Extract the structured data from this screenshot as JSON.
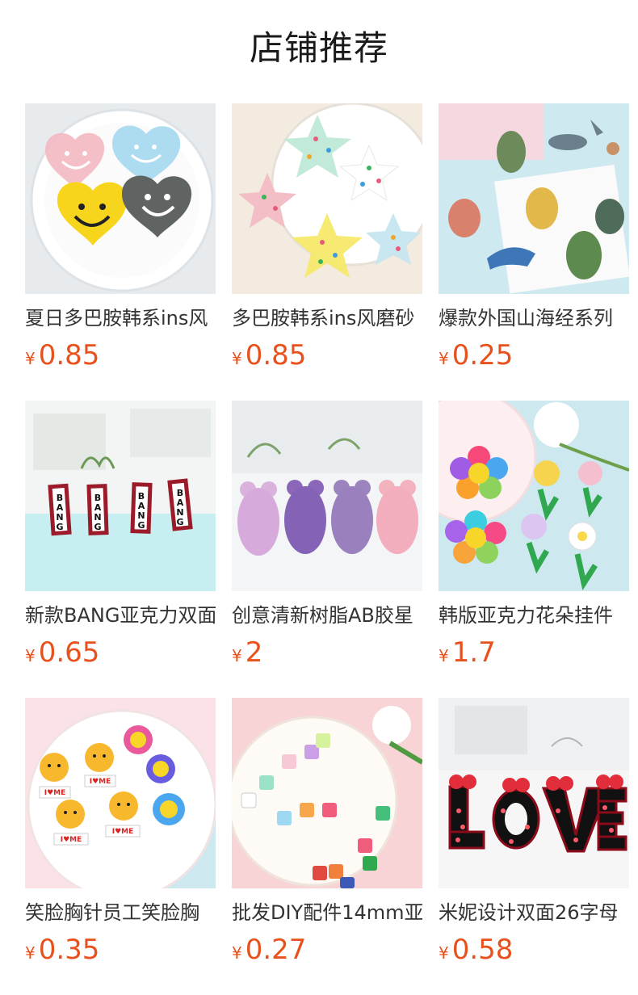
{
  "header": {
    "title": "店铺推荐"
  },
  "currency": "¥",
  "products": [
    {
      "title": "夏日多巴胺韩系ins风",
      "price": "0.85",
      "image": "smiley-heart-charms"
    },
    {
      "title": "多巴胺韩系ins风磨砂",
      "price": "0.85",
      "image": "star-charms"
    },
    {
      "title": "爆款外国山海经系列",
      "price": "0.25",
      "image": "mythical-creature-charms"
    },
    {
      "title": "新款BANG亚克力双面",
      "price": "0.65",
      "image": "bang-tag-charms"
    },
    {
      "title": "创意清新树脂AB胶星",
      "price": "2",
      "image": "glitter-bear-charms"
    },
    {
      "title": "韩版亚克力花朵挂件",
      "price": "1.7",
      "image": "flower-charms"
    },
    {
      "title": "笑脸胸针员工笑脸胸",
      "price": "0.35",
      "image": "smiley-brooch-charms"
    },
    {
      "title": "批发DIY配件14mm亚",
      "price": "0.27",
      "image": "dice-charms"
    },
    {
      "title": "米妮设计双面26字母",
      "price": "0.58",
      "image": "love-letter-charms"
    }
  ]
}
